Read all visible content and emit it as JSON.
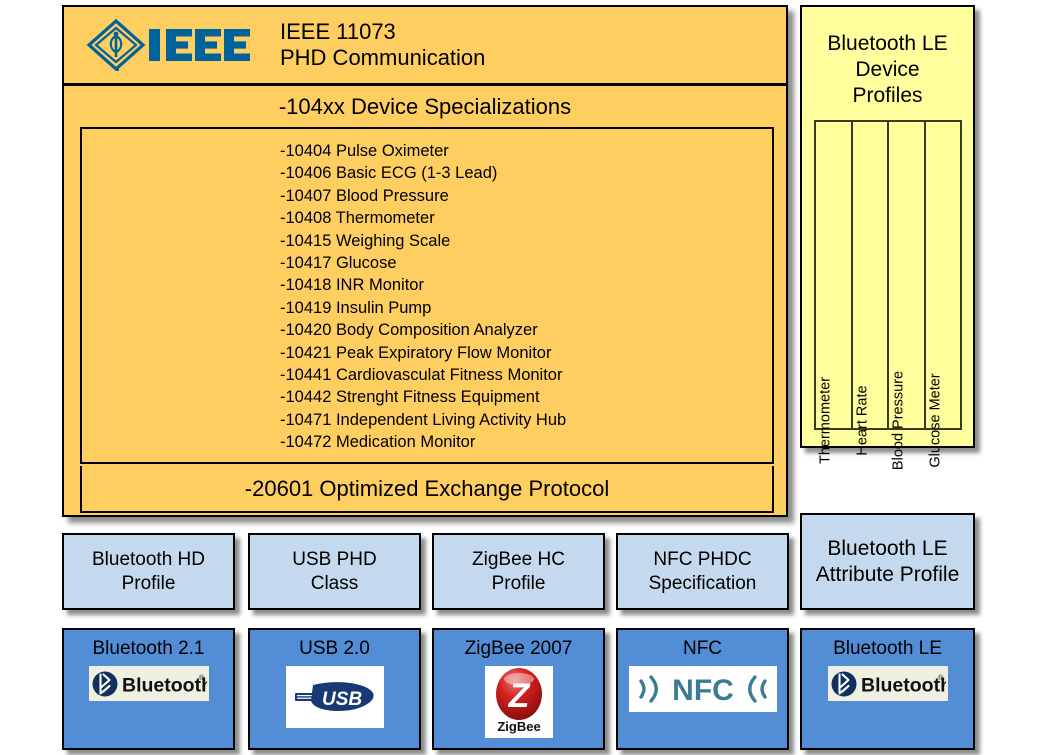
{
  "ieee_stack": {
    "logo_icon": "ieee-diamond-logo",
    "title": "IEEE 11073\nPHD Communication",
    "specializations_header": "-104xx  Device Specializations",
    "specializations": [
      "-10404 Pulse Oximeter",
      "-10406 Basic ECG (1-3 Lead)",
      "-10407 Blood Pressure",
      "-10408 Thermometer",
      "-10415 Weighing Scale",
      "-10417 Glucose",
      "-10418 INR Monitor",
      "-10419 Insulin Pump",
      "-10420 Body Composition Analyzer",
      "-10421 Peak Expiratory Flow Monitor",
      "-10441 Cardiovasculat Fitness Monitor",
      "-10442 Strenght Fitness Equipment",
      "-10471 Independent Living Activity Hub",
      "-10472 Medication Monitor"
    ],
    "protocol": "-20601 Optimized Exchange Protocol",
    "fill_color": "#FFCE60"
  },
  "ble_device_profiles": {
    "title": "Bluetooth LE\nDevice\nProfiles",
    "fill_color": "#FFFF9E",
    "columns": [
      "Thermometer",
      "Heart Rate",
      "Blood Pressure",
      "Glucose Meter"
    ]
  },
  "ble_attribute_profile": {
    "label": "Bluetooth LE\nAttribute Profile",
    "fill_color": "#C5D9EE"
  },
  "profile_row": {
    "fill_color": "#C5D9EE",
    "items": [
      {
        "label": "Bluetooth HD\nProfile"
      },
      {
        "label": "USB PHD\nClass"
      },
      {
        "label": "ZigBee HC\nProfile"
      },
      {
        "label": "NFC PHDC\nSpecification"
      }
    ]
  },
  "tech_row": {
    "fill_color": "#538DD5",
    "items": [
      {
        "label": "Bluetooth 2.1",
        "logo_icon": "bluetooth-logo",
        "logo_text": "Bluetooth"
      },
      {
        "label": "USB 2.0",
        "logo_icon": "usb-logo",
        "logo_text": "USB"
      },
      {
        "label": "ZigBee 2007",
        "logo_icon": "zigbee-logo",
        "logo_text": "ZigBee"
      },
      {
        "label": "NFC",
        "logo_icon": "nfc-logo",
        "logo_text": "NFC"
      },
      {
        "label": "Bluetooth LE",
        "logo_icon": "bluetooth-logo",
        "logo_text": "Bluetooth"
      }
    ]
  }
}
